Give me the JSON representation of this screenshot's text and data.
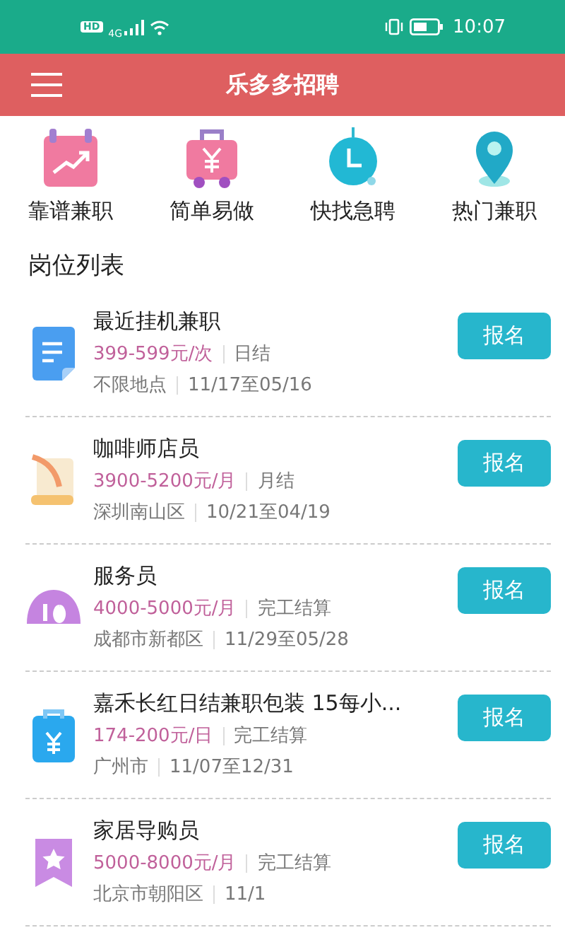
{
  "status_bar": {
    "time": "10:07",
    "hd": "HD",
    "network": "4G"
  },
  "header": {
    "title": "乐多多招聘"
  },
  "categories": [
    {
      "label": "靠谱兼职",
      "kind": "chart"
    },
    {
      "label": "简单易做",
      "kind": "suitcase"
    },
    {
      "label": "快找急聘",
      "kind": "clock"
    },
    {
      "label": "热门兼职",
      "kind": "pin"
    }
  ],
  "section_title": "岗位列表",
  "jobs": [
    {
      "title": "最近挂机兼职",
      "salary": "399-599元/次",
      "settlement": "日结",
      "location": "不限地点",
      "dates": "11/17至05/16",
      "kind": "document",
      "button": "报名"
    },
    {
      "title": "咖啡师店员",
      "salary": "3900-5200元/月",
      "settlement": "月结",
      "location": "深圳南山区",
      "dates": "10/21至04/19",
      "kind": "scroll",
      "button": "报名"
    },
    {
      "title": "服务员",
      "salary": "4000-5000元/月",
      "settlement": "完工结算",
      "location": "成都市新都区",
      "dates": "11/29至05/28",
      "kind": "dome",
      "button": "报名"
    },
    {
      "title": "嘉禾长红日结兼职包装 15每小...",
      "salary": "174-200元/日",
      "settlement": "完工结算",
      "location": "广州市",
      "dates": "11/07至12/31",
      "kind": "clipboard",
      "button": "报名"
    },
    {
      "title": "家居导购员",
      "salary": "5000-8000元/月",
      "settlement": "完工结算",
      "location": "北京市朝阳区",
      "dates": "11/1",
      "kind": "bookmark",
      "button": "报名"
    }
  ]
}
